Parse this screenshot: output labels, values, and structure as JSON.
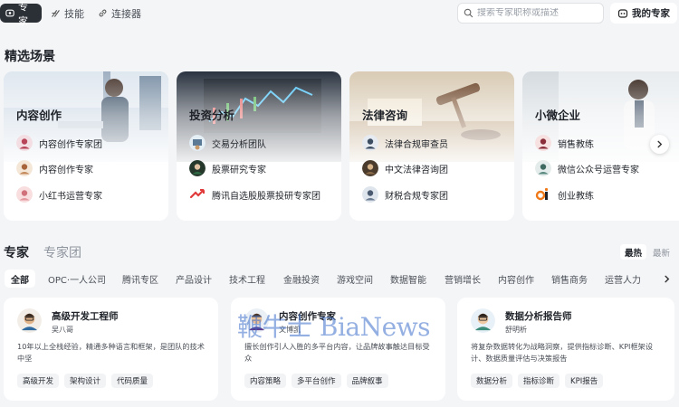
{
  "nav": {
    "tabs": [
      {
        "label": "专家",
        "icon": "expert-icon",
        "active": true
      },
      {
        "label": "技能",
        "icon": "skill-icon",
        "active": false
      },
      {
        "label": "连接器",
        "icon": "link-icon",
        "active": false
      }
    ],
    "search_placeholder": "搜索专家职称或描述",
    "my_experts_label": "我的专家"
  },
  "featured": {
    "title": "精选场景",
    "cards": [
      {
        "title": "内容创作",
        "items": [
          "内容创作专家团",
          "内容创作专家",
          "小红书运营专家"
        ]
      },
      {
        "title": "投资分析",
        "items": [
          "交易分析团队",
          "股票研究专家",
          "腾讯自选股股票投研专家团"
        ]
      },
      {
        "title": "法律咨询",
        "items": [
          "法律合规审查员",
          "中文法律咨询团",
          "财税合规专家团"
        ]
      },
      {
        "title": "小微企业",
        "items": [
          "销售教练",
          "微信公众号运营专家",
          "创业教练"
        ]
      }
    ]
  },
  "experts_section": {
    "tabs": [
      "专家",
      "专家团"
    ],
    "sort": [
      "最热",
      "最新"
    ],
    "categories": [
      "全部",
      "OPC·一人公司",
      "腾讯专区",
      "产品设计",
      "技术工程",
      "金融投资",
      "游戏空间",
      "数据智能",
      "营销增长",
      "内容创作",
      "销售商务",
      "运营人力"
    ],
    "cards": [
      {
        "name": "高级开发工程师",
        "author": "吴八哥",
        "desc": "10年以上全栈经验，精通多种语言和框架，是团队的技术中坚",
        "tags": [
          "高级开发",
          "架构设计",
          "代码质量"
        ]
      },
      {
        "name": "内容创作专家",
        "author": "文博凯",
        "desc": "擅长创作引人入胜的多平台内容，让品牌故事触达目标受众",
        "tags": [
          "内容策略",
          "多平台创作",
          "品牌叙事"
        ]
      },
      {
        "name": "数据分析报告师",
        "author": "舒明析",
        "desc": "将复杂数据转化为战略洞察，提供指标诊断、KPI框架设计、数据质量评估与决策报告",
        "tags": [
          "数据分析",
          "指标诊断",
          "KPI报告"
        ]
      }
    ]
  },
  "watermark": "鞭牛士 BiaNews"
}
